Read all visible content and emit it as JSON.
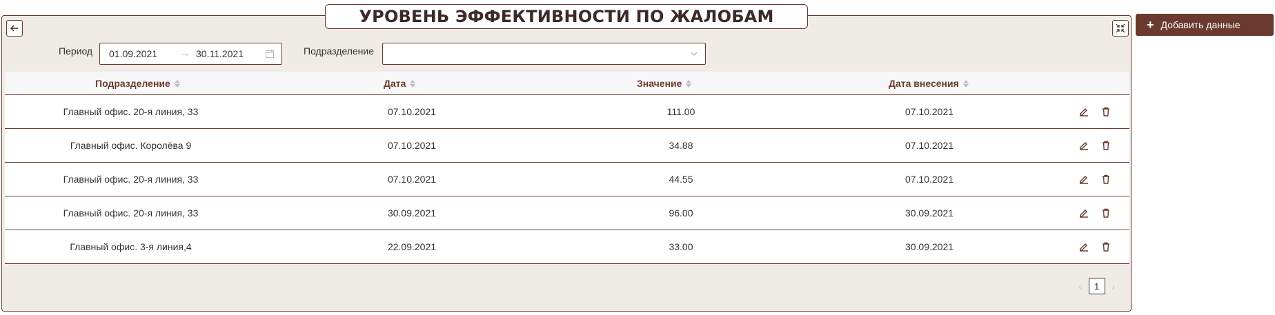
{
  "page": {
    "title": "УРОВЕНЬ ЭФФЕКТИВНОСТИ ПО ЖАЛОБАМ"
  },
  "toolbar": {
    "add_label": "Добавить данные"
  },
  "filters": {
    "period_label": "Период",
    "date_from": "01.09.2021",
    "date_to": "30.11.2021",
    "date_separator": "→",
    "department_label": "Подразделение",
    "department_value": ""
  },
  "table": {
    "headers": {
      "department": "Подразделение",
      "date": "Дата",
      "value": "Значение",
      "entry_date": "Дата внесения"
    },
    "rows": [
      {
        "department": "Главный офис. 20-я линия, 33",
        "date": "07.10.2021",
        "value": "111.00",
        "entry_date": "07.10.2021"
      },
      {
        "department": "Главный офис. Королёва 9",
        "date": "07.10.2021",
        "value": "34.88",
        "entry_date": "07.10.2021"
      },
      {
        "department": "Главный офис. 20-я линия, 33",
        "date": "07.10.2021",
        "value": "44.55",
        "entry_date": "07.10.2021"
      },
      {
        "department": "Главный офис. 20-я линия, 33",
        "date": "30.09.2021",
        "value": "96.00",
        "entry_date": "30.09.2021"
      },
      {
        "department": "Главный офис. 3-я линия,4",
        "date": "22.09.2021",
        "value": "33.00",
        "entry_date": "30.09.2021"
      }
    ]
  },
  "pagination": {
    "current_page": "1",
    "prev_symbol": "‹",
    "next_symbol": "›"
  },
  "icons": {
    "back": "arrow-left-icon",
    "expand": "compress-icon",
    "calendar": "calendar-icon",
    "chevron": "chevron-down-icon",
    "edit": "pencil-icon",
    "delete": "trash-icon",
    "add": "plus-icon"
  },
  "colors": {
    "brand": "#6b3a2e",
    "panel_bg": "#efebe7",
    "title_text": "#3b2a26"
  }
}
